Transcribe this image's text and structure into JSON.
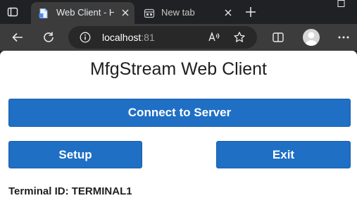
{
  "browser": {
    "tabs": [
      {
        "title": "Web Client - Ho",
        "active": true,
        "icon": "document-icon"
      },
      {
        "title": "New tab",
        "active": false,
        "icon": "new-tab-page-icon"
      }
    ],
    "address": {
      "host": "localhost",
      "port": ":81"
    },
    "colors": {
      "tabstrip": "#202124",
      "toolbar": "#3c3c3c",
      "omnibox": "#282828"
    }
  },
  "page": {
    "title": "MfgStream Web Client",
    "buttons": {
      "connect": "Connect to Server",
      "setup": "Setup",
      "exit": "Exit"
    },
    "terminal": "Terminal ID: TERMINAL1",
    "colors": {
      "button": "#1f6fc5",
      "text": "#1f1f1f"
    }
  }
}
